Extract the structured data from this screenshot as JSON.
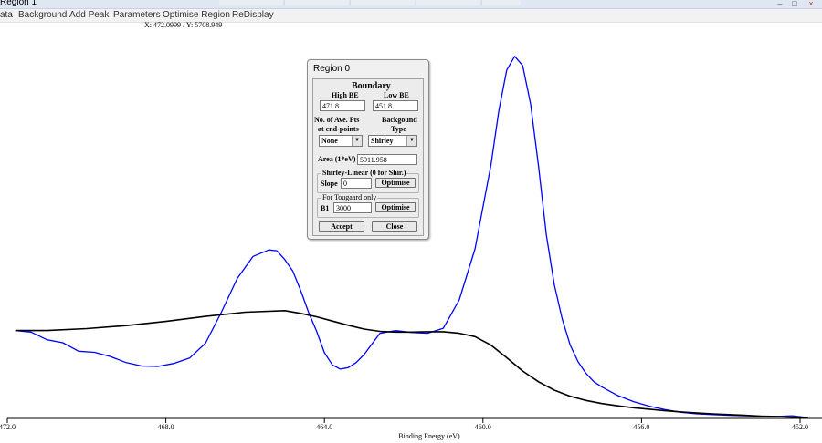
{
  "window": {
    "title": "Region 1",
    "controls": [
      "–",
      "□",
      "×"
    ]
  },
  "menu": [
    "ata",
    "Background",
    "Add Peak",
    "Parameters",
    "Optimise Region",
    "ReDisplay"
  ],
  "coordinates": "X: 472.0999 / Y: 5708.949",
  "dialog": {
    "title": "Region 0",
    "heading": "Boundary",
    "high_be_label": "High BE",
    "low_be_label": "Low BE",
    "high_be_value": "471.8",
    "low_be_value": "451.8",
    "ave_pts_label_1": "No. of Ave. Pts",
    "ave_pts_label_2": "at end-points",
    "bg_type_label_1": "Backgound",
    "bg_type_label_2": "Type",
    "ave_pts_value": "None",
    "bg_type_value": "Shirley",
    "area_label": "Area (1*eV)",
    "area_value": "5911.958",
    "shirley_group_label": "Shirley-Linear (0 for Shir.)",
    "slope_label": "Slope",
    "slope_value": "0",
    "optimise_label": "Optimise",
    "tougaard_group_label": "For Tougaard only",
    "b1_label": "B1",
    "b1_value": "3000",
    "accept_label": "Accept",
    "close_label": "Close"
  },
  "chart_data": {
    "type": "line",
    "xlabel": "Binding Energy (eV)",
    "ylabel": "",
    "xlim": [
      472.0,
      452.0
    ],
    "x_reversed": true,
    "xticks": [
      "472.0",
      "468.0",
      "464.0",
      "460.0",
      "456.0",
      "452.0"
    ],
    "xtick_values": [
      472,
      468,
      464,
      460,
      456,
      452
    ],
    "ylim": [
      0,
      100
    ],
    "grid": false,
    "series": [
      {
        "color": "#0000ff",
        "x": [
          471.8,
          471.4,
          471.0,
          470.6,
          470.2,
          469.8,
          469.4,
          469.0,
          468.6,
          468.2,
          467.8,
          467.4,
          467.0,
          466.6,
          466.2,
          465.8,
          465.4,
          465.2,
          465.0,
          464.8,
          464.6,
          464.4,
          464.2,
          464.0,
          463.8,
          463.6,
          463.4,
          463.2,
          463.0,
          462.6,
          462.2,
          461.8,
          461.4,
          461.0,
          460.6,
          460.2,
          459.8,
          459.6,
          459.4,
          459.2,
          459.0,
          458.8,
          458.6,
          458.4,
          458.2,
          458.0,
          457.8,
          457.6,
          457.4,
          457.2,
          457.0,
          456.6,
          456.2,
          455.8,
          455.4,
          455.0,
          454.6,
          454.2,
          453.8,
          453.4,
          453.0,
          452.6,
          452.2,
          451.8
        ],
        "y": [
          23.0,
          22.6,
          20.6,
          19.8,
          17.6,
          17.3,
          16.2,
          14.6,
          13.7,
          13.6,
          14.4,
          15.8,
          19.7,
          27.8,
          36.6,
          42.4,
          44.1,
          43.9,
          41.6,
          38.6,
          33.5,
          27.8,
          22.9,
          17.2,
          14.0,
          12.9,
          13.3,
          14.6,
          16.7,
          22.3,
          23.0,
          22.5,
          22.3,
          23.6,
          31.0,
          44.4,
          66.3,
          80.6,
          91.2,
          94.8,
          92.4,
          82.4,
          66.1,
          48.0,
          35.0,
          26.0,
          19.2,
          14.8,
          11.8,
          9.6,
          8.2,
          6.0,
          4.4,
          3.2,
          2.3,
          1.6,
          1.2,
          1.0,
          0.8,
          0.7,
          0.6,
          0.5,
          0.7,
          0.2
        ]
      },
      {
        "color": "#000000",
        "x": [
          471.8,
          471.0,
          470.0,
          469.0,
          468.0,
          467.0,
          466.0,
          465.0,
          464.6,
          464.2,
          463.8,
          463.4,
          463.0,
          462.6,
          462.2,
          461.8,
          461.4,
          461.0,
          460.6,
          460.2,
          459.8,
          459.4,
          459.0,
          458.6,
          458.2,
          457.8,
          457.4,
          457.0,
          456.6,
          456.2,
          455.8,
          455.4,
          455.0,
          454.6,
          454.2,
          453.8,
          453.4,
          453.0,
          452.6,
          452.2,
          451.8
        ],
        "y": [
          23.0,
          23.0,
          23.5,
          24.3,
          25.4,
          26.7,
          27.8,
          28.2,
          27.5,
          26.6,
          25.5,
          24.4,
          23.4,
          22.8,
          22.6,
          22.6,
          22.7,
          22.7,
          22.3,
          21.4,
          19.2,
          15.9,
          12.4,
          9.6,
          7.4,
          5.8,
          4.7,
          3.9,
          3.3,
          2.8,
          2.4,
          2.0,
          1.7,
          1.4,
          1.2,
          1.0,
          0.8,
          0.6,
          0.5,
          0.3,
          0.2
        ]
      }
    ]
  }
}
